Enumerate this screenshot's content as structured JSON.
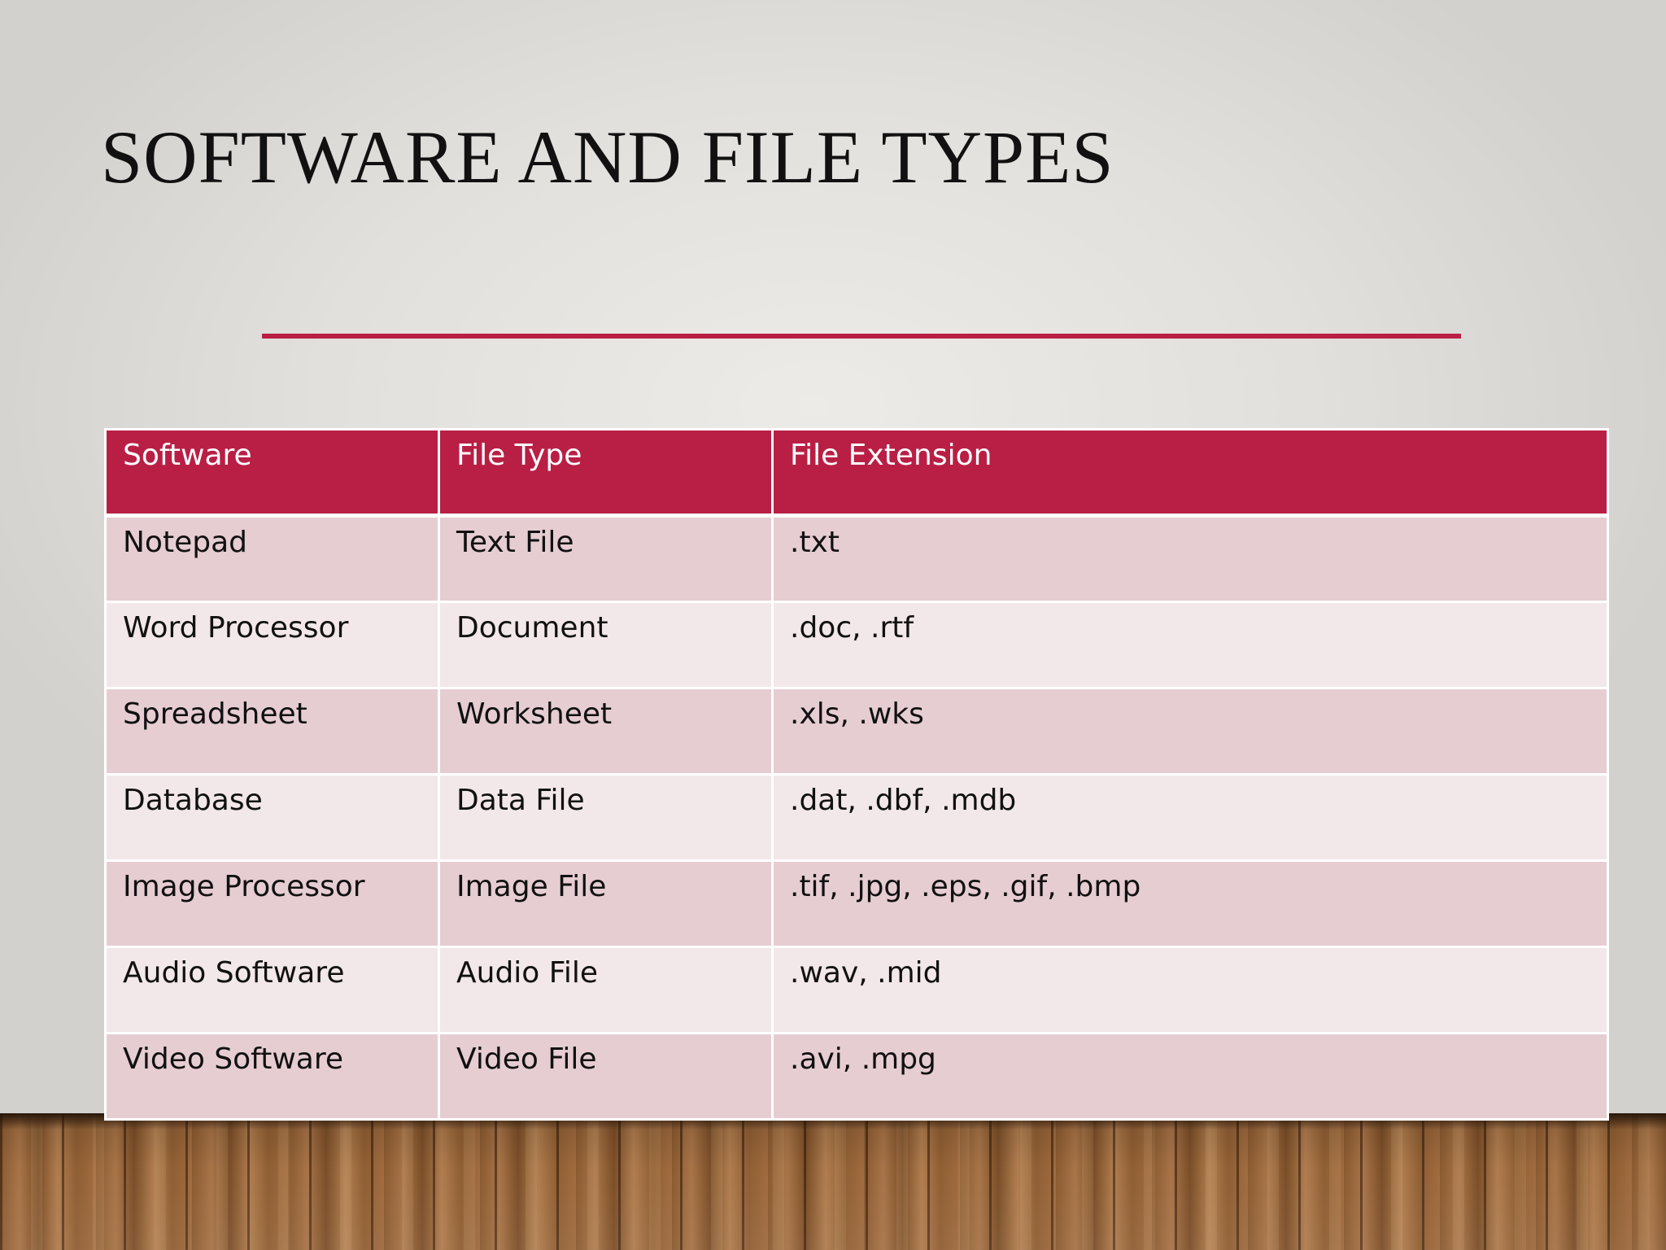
{
  "slide": {
    "title": "SOFTWARE AND FILE TYPES",
    "accent_color": "#b91f45"
  },
  "table": {
    "headers": [
      "Software",
      "File Type",
      "File Extension"
    ],
    "rows": [
      [
        "Notepad",
        "Text File",
        ".txt"
      ],
      [
        "Word Processor",
        "Document",
        ".doc, .rtf"
      ],
      [
        "Spreadsheet",
        "Worksheet",
        ".xls, .wks"
      ],
      [
        "Database",
        "Data File",
        ".dat, .dbf, .mdb"
      ],
      [
        "Image Processor",
        "Image File",
        ".tif, .jpg, .eps, .gif, .bmp"
      ],
      [
        "Audio Software",
        "Audio File",
        ".wav, .mid"
      ],
      [
        "Video Software",
        "Video File",
        ".avi, .mpg"
      ]
    ],
    "header_color": "#b91f45",
    "row_color_odd": "#e6cdd2",
    "row_color_even": "#f2e7e9"
  }
}
